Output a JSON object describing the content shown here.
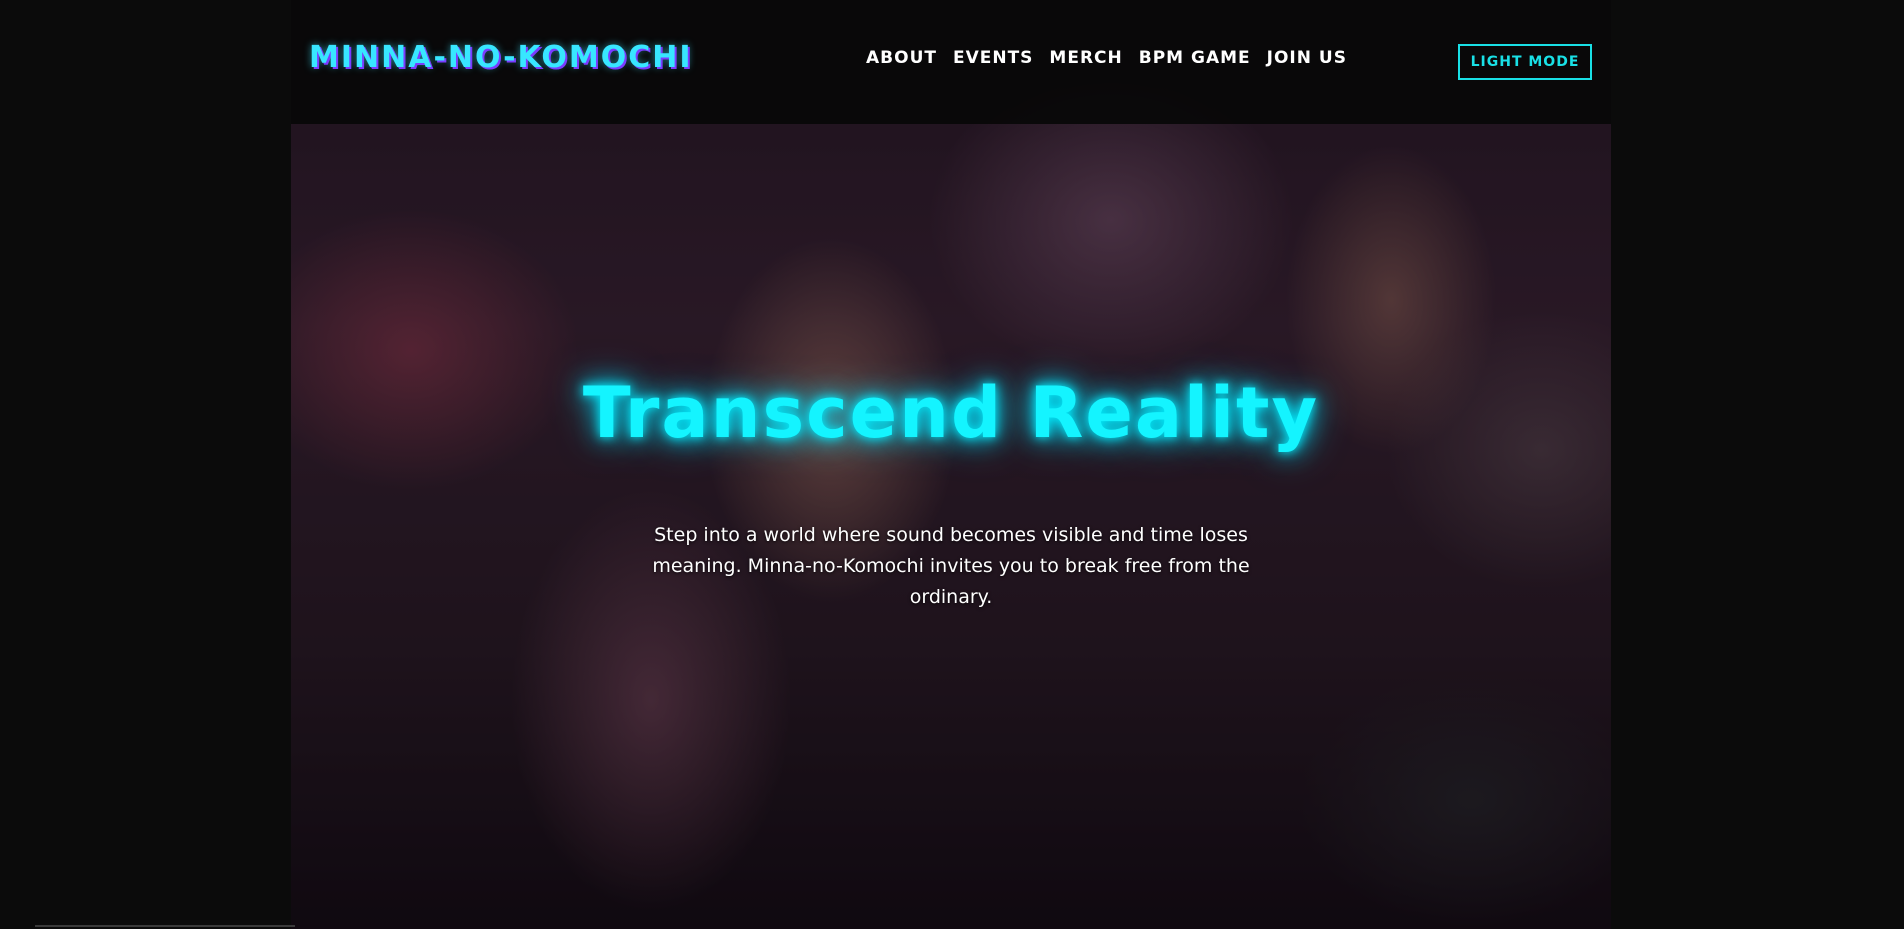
{
  "header": {
    "logo": "MINNA-NO-KOMOCHI",
    "nav": [
      {
        "label": "ABOUT"
      },
      {
        "label": "EVENTS"
      },
      {
        "label": "MERCH"
      },
      {
        "label": "BPM GAME"
      },
      {
        "label": "JOIN US"
      }
    ],
    "mode_button": "LIGHT MODE"
  },
  "hero": {
    "title": "Transcend Reality",
    "text": "Step into a world where sound becomes visible and time loses meaning. Minna-no-Komochi invites you to break free from the ordinary."
  },
  "colors": {
    "accent": "#14f4ff",
    "logo_shadow": "#7a3cff",
    "header_bg": "#080808",
    "page_bg": "#0b0b0b"
  }
}
